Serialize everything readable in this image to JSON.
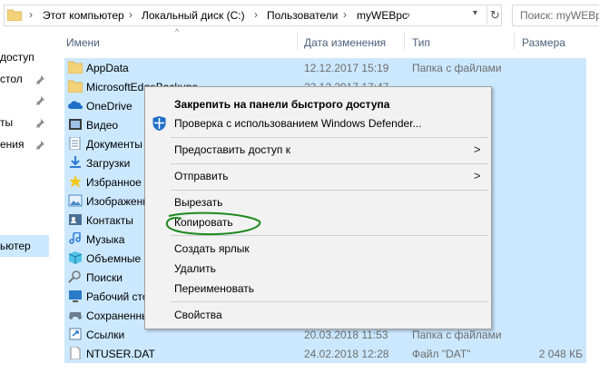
{
  "address": {
    "crumbs": [
      "Этот компьютер",
      "Локальный диск (C:)",
      "Пользователи",
      "myWEBpc"
    ],
    "search_placeholder": "Поиск: myWEBpc"
  },
  "nav": {
    "items": [
      "доступ",
      "стол",
      "ты",
      "ения",
      "ьютер"
    ]
  },
  "columns": {
    "name": "Имени",
    "date": "Дата изменения",
    "type": "Тип",
    "size": "Размера"
  },
  "files": [
    {
      "name": "AppData",
      "date": "12.12.2017 15:19",
      "type": "Папка с файлами",
      "size": "",
      "icon": "folder-icon"
    },
    {
      "name": "MicrosoftEdgeBackups",
      "date": "22.12.2017 17:47",
      "type": "",
      "size": "",
      "icon": "folder-icon"
    },
    {
      "name": "OneDrive",
      "date": "",
      "type": "",
      "size": "",
      "icon": "onedrive-icon"
    },
    {
      "name": "Видео",
      "date": "",
      "type": "",
      "size": "",
      "icon": "video-icon"
    },
    {
      "name": "Документы",
      "date": "",
      "type": "",
      "size": "",
      "icon": "documents-icon"
    },
    {
      "name": "Загрузки",
      "date": "",
      "type": "",
      "size": "",
      "icon": "downloads-icon"
    },
    {
      "name": "Избранное",
      "date": "",
      "type": "",
      "size": "",
      "icon": "favorites-icon"
    },
    {
      "name": "Изображения",
      "date": "",
      "type": "",
      "size": "",
      "icon": "pictures-icon"
    },
    {
      "name": "Контакты",
      "date": "",
      "type": "",
      "size": "",
      "icon": "contacts-icon"
    },
    {
      "name": "Музыка",
      "date": "",
      "type": "",
      "size": "",
      "icon": "music-icon"
    },
    {
      "name": "Объемные объекты",
      "date": "",
      "type": "",
      "size": "",
      "icon": "3d-objects-icon"
    },
    {
      "name": "Поиски",
      "date": "",
      "type": "",
      "size": "",
      "icon": "searches-icon"
    },
    {
      "name": "Рабочий стол",
      "date": "",
      "type": "",
      "size": "",
      "icon": "desktop-icon"
    },
    {
      "name": "Сохраненные игры",
      "date": "",
      "type": "",
      "size": "",
      "icon": "saved-games-icon"
    },
    {
      "name": "Ссылки",
      "date": "20.03.2018 11:53",
      "type": "Папка с файлами",
      "size": "",
      "icon": "links-icon"
    },
    {
      "name": "NTUSER.DAT",
      "date": "24.02.2018 12:28",
      "type": "Файл \"DAT\"",
      "size": "2 048 КБ",
      "icon": "file-icon"
    }
  ],
  "context_menu": {
    "pin": "Закрепить на панели быстрого доступа",
    "defender": "Проверка с использованием Windows Defender...",
    "share": "Предоставить доступ к",
    "send_to": "Отправить",
    "cut": "Вырезать",
    "copy": "Копировать",
    "create_shortcut": "Создать ярлык",
    "delete": "Удалить",
    "rename": "Переименовать",
    "properties": "Свойства"
  },
  "colors": {
    "selection": "#cce8ff",
    "highlight_circle": "#1e8a1e",
    "folder": "#f3d27a"
  }
}
